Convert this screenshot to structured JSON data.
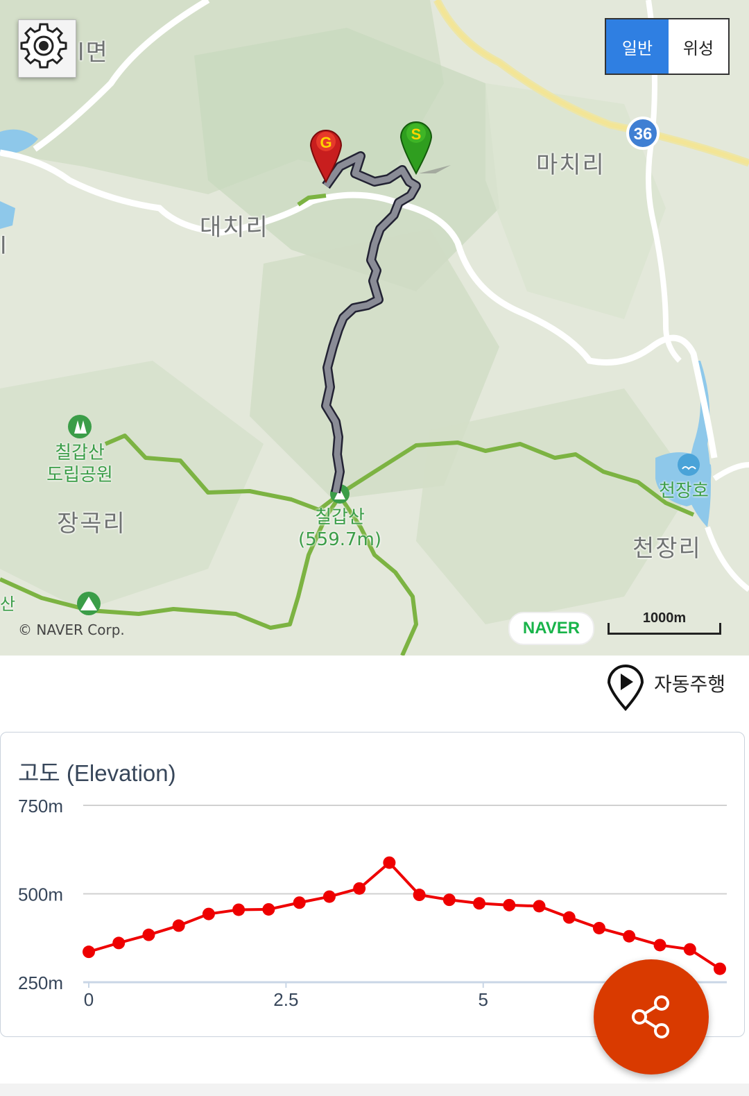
{
  "map": {
    "places": {
      "maechi": "마치리",
      "daechi": "대치리",
      "janggok": "장곡리",
      "cheonjang": "천장리",
      "partial_top": "l면",
      "partial_left": "l",
      "partial_bottom": "산"
    },
    "parks": {
      "chilgap_provincial_line1": "칠갑산",
      "chilgap_provincial_line2": "도립공원",
      "cheonjangho": "천장호",
      "peak_name": "칠갑산",
      "peak_height": "(559.7m)"
    },
    "route_number": "36",
    "map_type": {
      "general": "일반",
      "satellite": "위성",
      "selected": "general"
    },
    "copyright": "© NAVER Corp.",
    "logo": "NAVER",
    "scale": "1000m",
    "markers": {
      "start": "S",
      "goal": "G"
    },
    "colors": {
      "track": "#7a7e8c",
      "trail": "#7cb342",
      "start": "#2f9e1f",
      "goal": "#c81e1e"
    }
  },
  "autoplay": {
    "label": "자동주행",
    "icon": "play-pin-icon"
  },
  "elevation": {
    "title": "고도 (Elevation)",
    "line_color": "#ee0000"
  },
  "chart_data": {
    "type": "line",
    "title": "고도 (Elevation)",
    "y_tick_labels": [
      "750m",
      "500m",
      "250m"
    ],
    "x_tick_labels": [
      "0",
      "2.5",
      "5"
    ],
    "ylim": [
      250,
      750
    ],
    "xlim": [
      0,
      8
    ],
    "grid": true,
    "series": [
      {
        "x": [
          0,
          0.38,
          0.76,
          1.14,
          1.52,
          1.9,
          2.28,
          2.67,
          3.05,
          3.43,
          3.81,
          4.19,
          4.57,
          4.95,
          5.33,
          5.71,
          6.09,
          6.47,
          6.85,
          7.24,
          7.62,
          8.0
        ],
        "y": [
          336,
          361,
          384,
          410,
          443,
          455,
          456,
          475,
          492,
          515,
          588,
          497,
          483,
          473,
          468,
          465,
          433,
          403,
          380,
          355,
          343,
          288
        ]
      }
    ]
  },
  "fab": {
    "icon": "share-icon"
  }
}
